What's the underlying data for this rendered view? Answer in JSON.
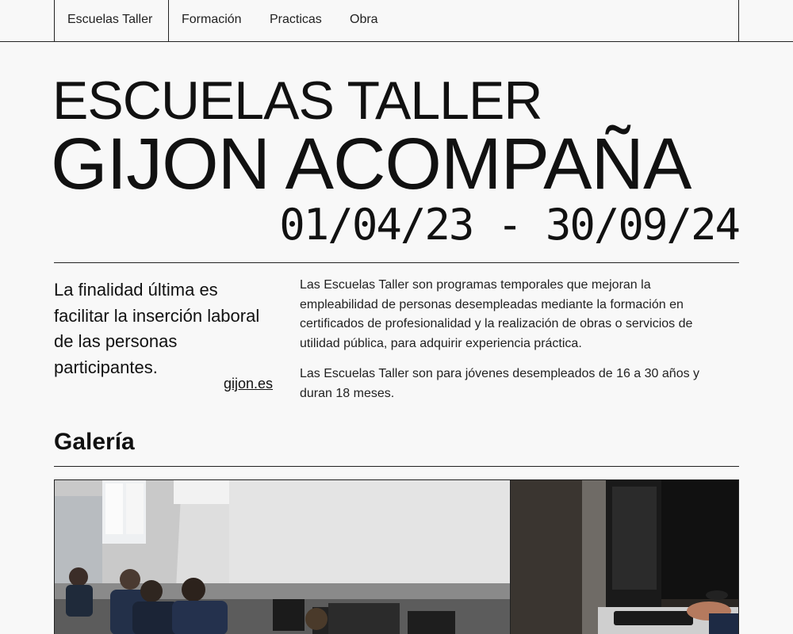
{
  "nav": {
    "items": [
      "Escuelas Taller",
      "Formación",
      "Practicas",
      "Obra"
    ]
  },
  "hero": {
    "line1": "ESCUELAS TALLER",
    "line2": "GIJON ACOMPAÑA",
    "dates": "01/04/23 - 30/09/24"
  },
  "intro": {
    "quote": "La finalidad última es facilitar la inserción laboral de las personas participantes.",
    "source": "gijon.es",
    "paragraphs": [
      "Las Escuelas Taller son programas temporales que mejoran la empleabilidad de personas desempleadas mediante la formación en certificados de profesionalidad y la realización de obras o servicios de utilidad pública, para adquirir experiencia práctica.",
      "Las Escuelas Taller son para jóvenes desempleados de 16 a 30 años y duran 18 meses."
    ]
  },
  "gallery": {
    "title": "Galería"
  }
}
